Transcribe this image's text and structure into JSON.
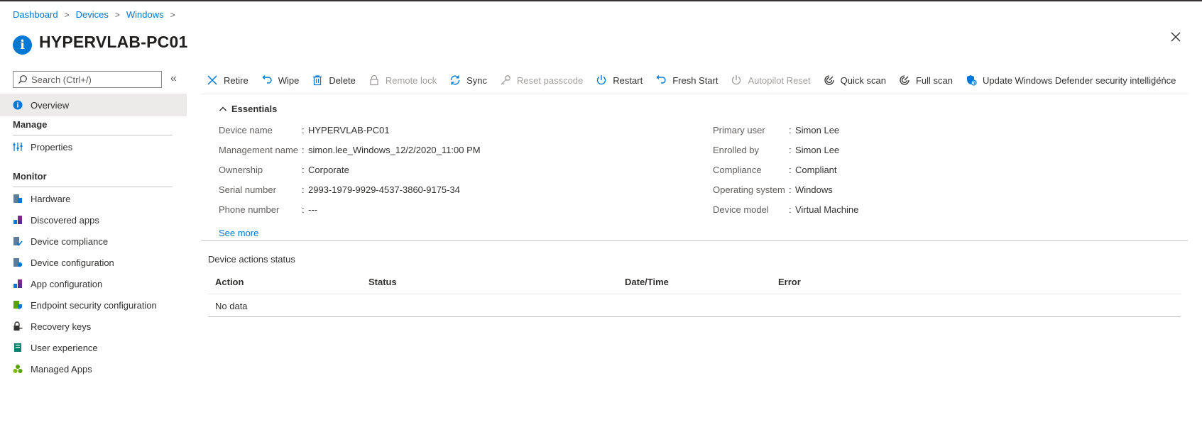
{
  "breadcrumb": [
    "Dashboard",
    "Devices",
    "Windows"
  ],
  "title": "HYPERVLAB-PC01",
  "search": {
    "placeholder": "Search (Ctrl+/)"
  },
  "sidebar": {
    "overview": "Overview",
    "manage_heading": "Manage",
    "manage_items": [
      {
        "label": "Properties",
        "icon": "properties-icon"
      }
    ],
    "monitor_heading": "Monitor",
    "monitor_items": [
      {
        "label": "Hardware",
        "icon": "hardware-icon"
      },
      {
        "label": "Discovered apps",
        "icon": "apps-icon"
      },
      {
        "label": "Device compliance",
        "icon": "compliance-icon"
      },
      {
        "label": "Device configuration",
        "icon": "configuration-icon"
      },
      {
        "label": "App configuration",
        "icon": "app-configuration-icon"
      },
      {
        "label": "Endpoint security configuration",
        "icon": "endpoint-security-icon"
      },
      {
        "label": "Recovery keys",
        "icon": "key-icon"
      },
      {
        "label": "User experience",
        "icon": "book-icon"
      },
      {
        "label": "Managed Apps",
        "icon": "managed-apps-icon"
      }
    ]
  },
  "toolbar": {
    "items": [
      {
        "label": "Retire",
        "icon": "close-icon",
        "disabled": false
      },
      {
        "label": "Wipe",
        "icon": "undo-icon",
        "disabled": false
      },
      {
        "label": "Delete",
        "icon": "trash-icon",
        "disabled": false
      },
      {
        "label": "Remote lock",
        "icon": "lock-icon",
        "disabled": true
      },
      {
        "label": "Sync",
        "icon": "sync-icon",
        "disabled": false
      },
      {
        "label": "Reset passcode",
        "icon": "key-icon",
        "disabled": true
      },
      {
        "label": "Restart",
        "icon": "power-icon",
        "disabled": false
      },
      {
        "label": "Fresh Start",
        "icon": "refresh-icon",
        "disabled": false
      },
      {
        "label": "Autopilot Reset",
        "icon": "power-icon",
        "disabled": true
      },
      {
        "label": "Quick scan",
        "icon": "scan-icon",
        "disabled": false
      },
      {
        "label": "Full scan",
        "icon": "scan-icon",
        "disabled": false
      },
      {
        "label": "Update Windows Defender security intelligence",
        "icon": "shield-update-icon",
        "disabled": false
      }
    ],
    "more": "···"
  },
  "essentials": {
    "label": "Essentials",
    "left": [
      {
        "key": "Device name",
        "value": "HYPERVLAB-PC01"
      },
      {
        "key": "Management name",
        "value": "simon.lee_Windows_12/2/2020_11:00 PM"
      },
      {
        "key": "Ownership",
        "value": "Corporate"
      },
      {
        "key": "Serial number",
        "value": "2993-1979-9929-4537-3860-9175-34"
      },
      {
        "key": "Phone number",
        "value": "---"
      }
    ],
    "right": [
      {
        "key": "Primary user",
        "value": "Simon Lee",
        "link": true
      },
      {
        "key": "Enrolled by",
        "value": "Simon Lee",
        "link": true
      },
      {
        "key": "Compliance",
        "value": "Compliant",
        "link": false
      },
      {
        "key": "Operating system",
        "value": "Windows",
        "link": false
      },
      {
        "key": "Device model",
        "value": "Virtual Machine",
        "link": false
      }
    ],
    "see_more": "See more"
  },
  "device_actions": {
    "title": "Device actions status",
    "columns": [
      "Action",
      "Status",
      "Date/Time",
      "Error"
    ],
    "empty": "No data"
  },
  "colors": {
    "accent": "#0078d4",
    "text": "#323130",
    "disabled": "#a19f9d",
    "selected_bg": "#edebe9"
  }
}
